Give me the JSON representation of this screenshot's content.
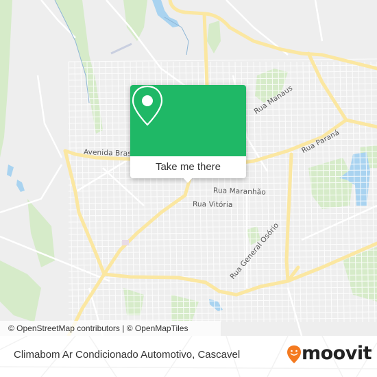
{
  "map": {
    "street_labels": [
      {
        "id": "avenida-brasil",
        "text": "Avenida Bras"
      },
      {
        "id": "rua-manaus",
        "text": "Rua Manaus"
      },
      {
        "id": "rua-parana",
        "text": "Rua Paraná"
      },
      {
        "id": "rua-maranhao",
        "text": "Rua Maranhão"
      },
      {
        "id": "rua-vitoria",
        "text": "Rua Vitória"
      },
      {
        "id": "rua-general-osorio",
        "text": "Rua General Osório"
      }
    ],
    "attribution": "© OpenStreetMap contributors | © OpenMapTiles",
    "colors": {
      "background": "#eeeeee",
      "major_road": "#fbe9a6",
      "minor_road": "#ffffff",
      "park": "#d4ebc6",
      "water": "#a8d4f0"
    }
  },
  "popup": {
    "icon": "map-pin-icon",
    "button_label": "Take me there",
    "accent_color": "#1fb866"
  },
  "footer": {
    "title": "Climabom Ar Condicionado Automotivo, Cascavel",
    "logo_text": "moovit",
    "logo_icon": "moovit-smiley-pin-icon",
    "logo_color": "#f47a20"
  }
}
